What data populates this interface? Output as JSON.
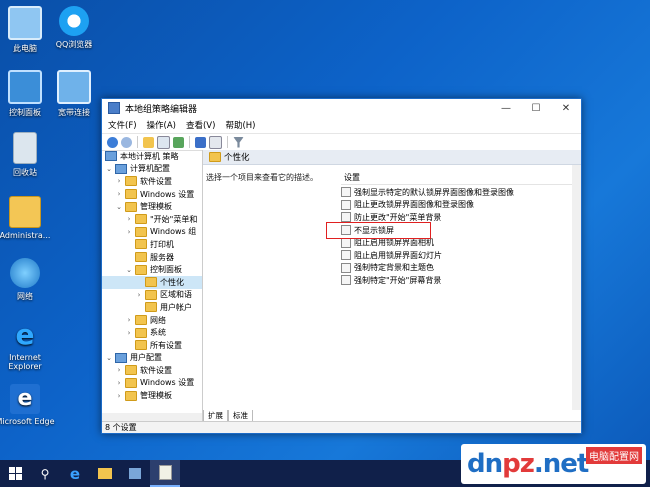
{
  "desktop": {
    "icons": [
      {
        "label": "此电脑"
      },
      {
        "label": "QQ浏览器"
      },
      {
        "label": "控制面板"
      },
      {
        "label": "宽带连接"
      },
      {
        "label": "回收站"
      },
      {
        "label": "Administra..."
      },
      {
        "label": "网络"
      },
      {
        "label": "Internet Explorer"
      },
      {
        "label": "Microsoft Edge"
      }
    ]
  },
  "window": {
    "title": "本地组策略编辑器",
    "menu": [
      "文件(F)",
      "操作(A)",
      "查看(V)",
      "帮助(H)"
    ],
    "tree": [
      {
        "label": "本地计算机 策略"
      },
      {
        "label": "计算机配置"
      },
      {
        "label": "软件设置"
      },
      {
        "label": "Windows 设置"
      },
      {
        "label": "管理模板"
      },
      {
        "label": "\"开始\"菜单和"
      },
      {
        "label": "Windows 组"
      },
      {
        "label": "打印机"
      },
      {
        "label": "服务器"
      },
      {
        "label": "控制面板"
      },
      {
        "label": "个性化"
      },
      {
        "label": "区域和语"
      },
      {
        "label": "用户帐户"
      },
      {
        "label": "网络"
      },
      {
        "label": "系统"
      },
      {
        "label": "所有设置"
      },
      {
        "label": "用户配置"
      },
      {
        "label": "软件设置"
      },
      {
        "label": "Windows 设置"
      },
      {
        "label": "管理模板"
      }
    ],
    "content_title": "个性化",
    "description": "选择一个项目来查看它的描述。",
    "column_header": "设置",
    "settings": [
      "强制显示特定的默认锁屏界面图像和登录图像",
      "阻止更改锁屏界面图像和登录图像",
      "防止更改\"开始\"菜单背景",
      "不显示锁屏",
      "阻止启用锁屏界面相机",
      "阻止启用锁屏界面幻灯片",
      "强制特定背景和主题色",
      "强制特定\"开始\"屏幕背景"
    ],
    "tabs": [
      "扩展",
      "标准"
    ],
    "status": "8 个设置"
  },
  "watermark": {
    "text": "dnpz.net",
    "sub": "电脑配置网"
  }
}
